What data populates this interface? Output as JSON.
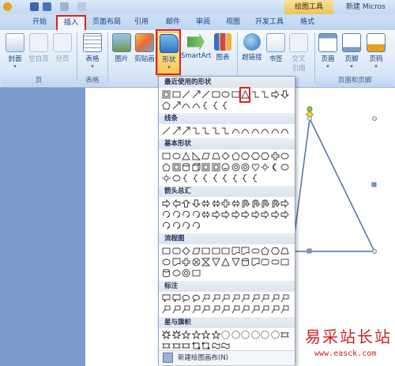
{
  "titlebar": {
    "tool_tab": "绘图工具",
    "doc_title": "新建 Micros"
  },
  "tabs": [
    {
      "label": "开始"
    },
    {
      "label": "插入"
    },
    {
      "label": "页面布局"
    },
    {
      "label": "引用"
    },
    {
      "label": "邮件"
    },
    {
      "label": "审阅"
    },
    {
      "label": "视图"
    },
    {
      "label": "开发工具"
    },
    {
      "label": "格式"
    }
  ],
  "ribbon": {
    "buttons": [
      {
        "label": "封面"
      },
      {
        "label": "空白页"
      },
      {
        "label": "分页"
      },
      {
        "label": "表格"
      },
      {
        "label": "图片"
      },
      {
        "label": "剪贴画"
      },
      {
        "label": "形状"
      },
      {
        "label": "SmartArt"
      },
      {
        "label": "图表"
      },
      {
        "label": "超链接"
      },
      {
        "label": "书签"
      },
      {
        "label": "交叉",
        "label2": "引用"
      },
      {
        "label": "页眉"
      },
      {
        "label": "页脚"
      },
      {
        "label": "页码"
      }
    ],
    "groups": [
      {
        "label": "页"
      },
      {
        "label": "表格"
      },
      {
        "label": "页眉和页脚"
      }
    ],
    "caret": "▾"
  },
  "dropdown": {
    "sections": [
      {
        "title": "最近使用的形状"
      },
      {
        "title": "线条"
      },
      {
        "title": "基本形状"
      },
      {
        "title": "箭头总汇"
      },
      {
        "title": "流程图"
      },
      {
        "title": "标注"
      },
      {
        "title": "星与旗帜"
      }
    ],
    "footer": "新建绘图画布(N)"
  },
  "watermark": {
    "text": "易采站长站",
    "url": "www.easck.com"
  },
  "colors": {
    "highlight": "#e02020",
    "accent": "#15428b"
  }
}
